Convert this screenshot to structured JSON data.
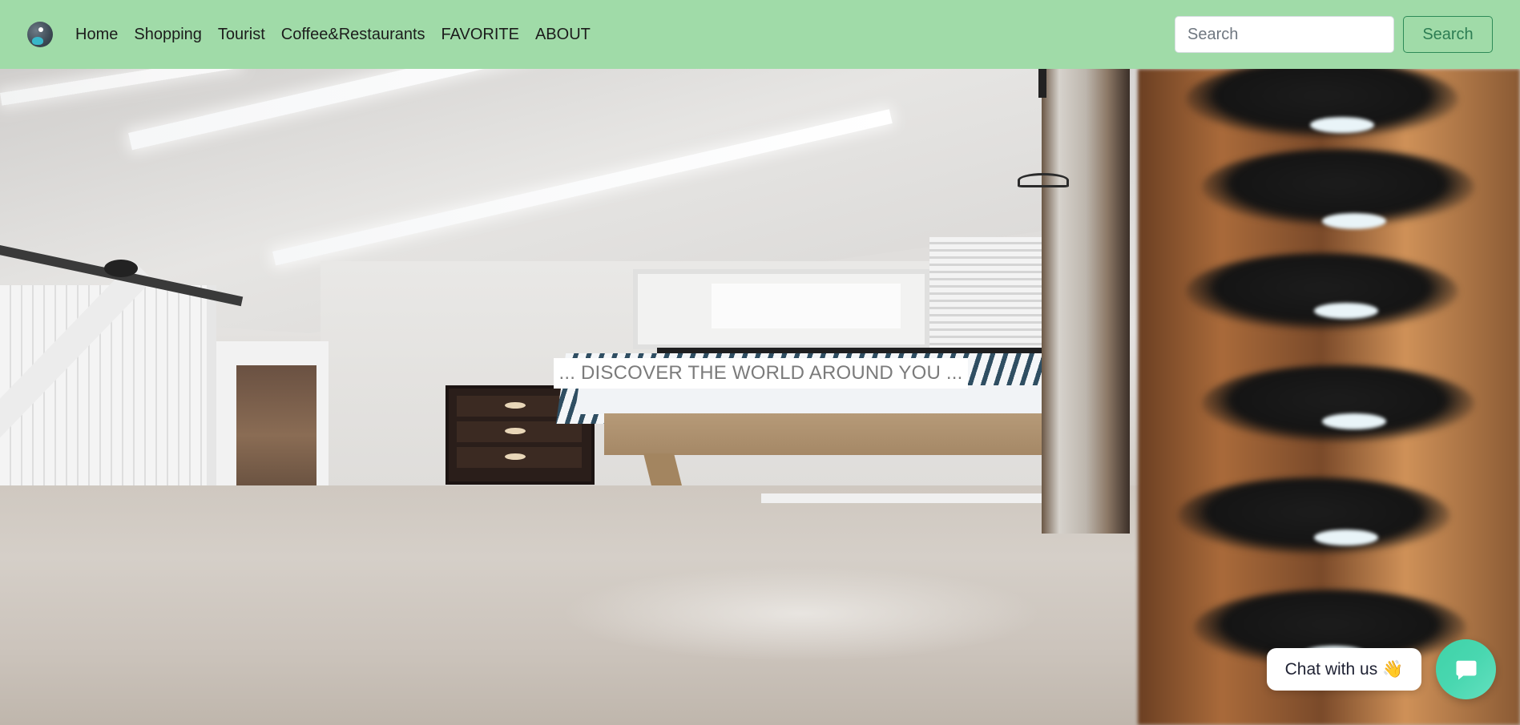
{
  "navbar": {
    "logo_icon": "globe-icon",
    "links": [
      {
        "label": "Home"
      },
      {
        "label": "Shopping"
      },
      {
        "label": "Tourist"
      },
      {
        "label": "Coffee&Restaurants"
      },
      {
        "label": "FAVORITE"
      },
      {
        "label": "ABOUT"
      }
    ],
    "search": {
      "placeholder": "Search",
      "value": "",
      "button_label": "Search"
    },
    "colors": {
      "background": "#a0dba8",
      "search_button": "#2d7d53"
    }
  },
  "hero": {
    "caption": "... DISCOVER THE WORLD AROUND YOU ..."
  },
  "chat": {
    "label": "Chat with us",
    "emoji": "👋",
    "bubble_icon": "chat-bubble-icon",
    "bubble_color": "#49d7b0"
  }
}
